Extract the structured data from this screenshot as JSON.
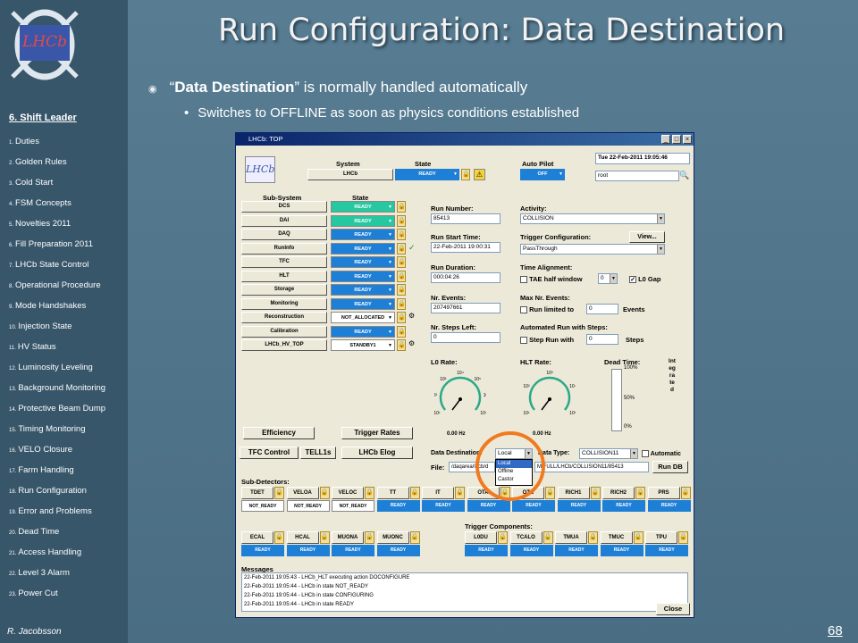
{
  "title": "Run Configuration: Data Destination",
  "bullet1_quote_open": "“",
  "bullet1_bold": "Data Destination",
  "bullet1_rest": "” is normally handled automatically",
  "bullet2": "Switches to OFFLINE as soon as physics conditions established",
  "sidebar": {
    "heading": "6. Shift Leader",
    "items": [
      {
        "n": "1.",
        "label": "Duties"
      },
      {
        "n": "2.",
        "label": "Golden Rules"
      },
      {
        "n": "3.",
        "label": "Cold Start"
      },
      {
        "n": "4.",
        "label": "FSM Concepts"
      },
      {
        "n": "5.",
        "label": "Novelties 2011"
      },
      {
        "n": "6.",
        "label": "Fill Preparation 2011"
      },
      {
        "n": "7.",
        "label": "LHCb State Control"
      },
      {
        "n": "8.",
        "label": "Operational Procedure"
      },
      {
        "n": "9.",
        "label": "Mode Handshakes"
      },
      {
        "n": "10.",
        "label": "Injection State"
      },
      {
        "n": "11.",
        "label": "HV Status"
      },
      {
        "n": "12.",
        "label": "Luminosity Leveling"
      },
      {
        "n": "13.",
        "label": "Background Monitoring"
      },
      {
        "n": "14.",
        "label": "Protective Beam Dump"
      },
      {
        "n": "15.",
        "label": "Timing Monitoring"
      },
      {
        "n": "16.",
        "label": "VELO Closure"
      },
      {
        "n": "17.",
        "label": "Farm Handling"
      },
      {
        "n": "18.",
        "label": "Run Configuration"
      },
      {
        "n": "19.",
        "label": "Error and Problems"
      },
      {
        "n": "20.",
        "label": "Dead Time"
      },
      {
        "n": "21.",
        "label": "Access Handling"
      },
      {
        "n": "22.",
        "label": "Level 3 Alarm"
      },
      {
        "n": "23.",
        "label": "Power Cut"
      }
    ]
  },
  "author": "R. Jacobsson",
  "page_number": "68",
  "logo_text": "LHCb",
  "window": {
    "title": "LHCb: TOP",
    "system_label": "System",
    "state_label": "State",
    "autopilot_label": "Auto Pilot",
    "system_value": "LHCb",
    "system_state": "READY",
    "autopilot_value": "OFF",
    "datetime": "Tue 22-Feb-2011      19:05:46",
    "user": "root",
    "subsystem_label": "Sub-System",
    "subsystem_state_label": "State",
    "subsystems": [
      {
        "name": "DCS",
        "state": "READY",
        "color": "#27c7a0"
      },
      {
        "name": "DAI",
        "state": "READY",
        "color": "#27c7a0"
      },
      {
        "name": "DAQ",
        "state": "READY",
        "color": "#1e7fd6"
      },
      {
        "name": "RunInfo",
        "state": "READY",
        "color": "#1e7fd6"
      },
      {
        "name": "TFC",
        "state": "READY",
        "color": "#1e7fd6"
      },
      {
        "name": "HLT",
        "state": "READY",
        "color": "#1e7fd6"
      },
      {
        "name": "Storage",
        "state": "READY",
        "color": "#1e7fd6"
      },
      {
        "name": "Monitoring",
        "state": "READY",
        "color": "#1e7fd6"
      },
      {
        "name": "Reconstruction",
        "state": "NOT_ALLOCATED",
        "color": "#ffffff"
      },
      {
        "name": "Calibration",
        "state": "READY",
        "color": "#1e7fd6"
      },
      {
        "name": "LHCb_HV_TOP",
        "state": "STANDBY1",
        "color": "#ffffff"
      }
    ],
    "run_number_label": "Run Number:",
    "run_number": "85413",
    "run_start_label": "Run Start Time:",
    "run_start": "22-Feb-2011 19:00:31",
    "run_duration_label": "Run Duration:",
    "run_duration": "000:04:26",
    "nr_events_label": "Nr. Events:",
    "nr_events": "207497661",
    "nr_steps_label": "Nr. Steps Left:",
    "nr_steps": "0",
    "activity_label": "Activity:",
    "activity": "COLLISION",
    "trigger_config_label": "Trigger Configuration:",
    "view_button": "View...",
    "trigger_config": "PassThrough",
    "time_align_label": "Time Alignment:",
    "tae_label": "TAE half window",
    "tae_value": "0",
    "l0gap_label": "L0 Gap",
    "max_events_label": "Max Nr. Events:",
    "run_limited_label": "Run limited to",
    "run_limited_value": "0",
    "events_label": "Events",
    "auto_steps_label": "Automated Run with Steps:",
    "step_run_label": "Step Run with",
    "step_value": "0",
    "steps_label": "Steps",
    "l0_rate_label": "L0 Rate:",
    "l0_rate_value": "0.00 Hz",
    "hlt_rate_label": "HLT Rate:",
    "hlt_rate_value": "0.00 Hz",
    "dead_time_label": "Dead Time:",
    "dt_100": "100%",
    "dt_50": "50%",
    "dt_0": "0%",
    "integrated_label": "Integrated",
    "gauge_ticks_l0": [
      "10¹",
      "10²",
      "10³",
      "10⁴",
      "10⁵",
      "10⁶",
      "10⁷"
    ],
    "gauge_ticks_hlt": [
      "10¹",
      "10²",
      "10³",
      "10⁴",
      "10⁵"
    ],
    "efficiency_button": "Efficiency",
    "trigger_rates_button": "Trigger Rates",
    "tfc_button": "TFC Control",
    "tell1s_button": "TELL1s",
    "elog_button": "LHCb Elog",
    "data_dest_label": "Data Destination:",
    "data_dest_value": "Local",
    "data_dest_options": [
      "Local",
      "Offline",
      "Castor"
    ],
    "data_type_label": "Data Type:",
    "data_type_value": "COLLISION11",
    "automatic_label": "Automatic",
    "file_label": "File:",
    "file_path_start": "/daqarea/lhcb/d",
    "file_path_end": "M/FULL/LHCb/COLLISION11/85413",
    "run_db_button": "Run DB",
    "subdetectors_label": "Sub-Detectors:",
    "subdetectors": [
      {
        "name": "TDET",
        "state": "NOT_READY"
      },
      {
        "name": "VELOA",
        "state": "NOT_READY"
      },
      {
        "name": "VELOC",
        "state": "NOT_READY"
      },
      {
        "name": "TT",
        "state": "READY"
      },
      {
        "name": "IT",
        "state": "READY"
      },
      {
        "name": "OTA",
        "state": "READY"
      },
      {
        "name": "OTC",
        "state": "READY"
      },
      {
        "name": "RICH1",
        "state": "READY"
      },
      {
        "name": "RICH2",
        "state": "READY"
      },
      {
        "name": "PRS",
        "state": "READY"
      }
    ],
    "subdetectors2": [
      {
        "name": "ECAL",
        "state": "READY"
      },
      {
        "name": "HCAL",
        "state": "READY"
      },
      {
        "name": "MUONA",
        "state": "READY"
      },
      {
        "name": "MUONC",
        "state": "READY"
      }
    ],
    "trigger_components_label": "Trigger Components:",
    "trigger_components": [
      {
        "name": "L0DU",
        "state": "READY"
      },
      {
        "name": "TCALO",
        "state": "READY"
      },
      {
        "name": "TMUA",
        "state": "READY"
      },
      {
        "name": "TMUC",
        "state": "READY"
      },
      {
        "name": "TPU",
        "state": "READY"
      }
    ],
    "messages_label": "Messages",
    "messages": [
      "22-Feb-2011 19:05:43 - LHCb_HLT executing action DOCONFIGURE",
      "22-Feb-2011 19:05:44 - LHCb in state NOT_READY",
      "22-Feb-2011 19:05:44 - LHCb in state CONFIGURING",
      "22-Feb-2011 19:05:44 - LHCb in state READY"
    ],
    "close_button": "Close"
  },
  "highlight_color": "#f07a20"
}
